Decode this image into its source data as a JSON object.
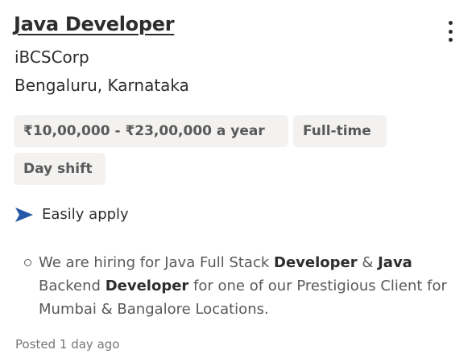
{
  "job": {
    "title": "Java Developer",
    "company": "iBCSCorp",
    "location": "Bengaluru, Karnataka",
    "more_icon": "more-vertical-icon",
    "tags": {
      "salary": "₹10,00,000 - ₹23,00,000 a year",
      "type": "Full-time",
      "shift": "Day shift"
    },
    "apply": {
      "icon": "send-arrow-icon",
      "label": "Easily apply",
      "icon_color": "#2557a7"
    },
    "snippet": {
      "seg1": "We are hiring for Java Full Stack ",
      "seg2": "Developer",
      "seg3": " & ",
      "seg4": "Java",
      "seg5": " Backend ",
      "seg6": "Developer",
      "seg7": " for one of our Prestigious Client for Mumbai & Bangalore Locations."
    },
    "posted": "Posted 1 day ago"
  }
}
